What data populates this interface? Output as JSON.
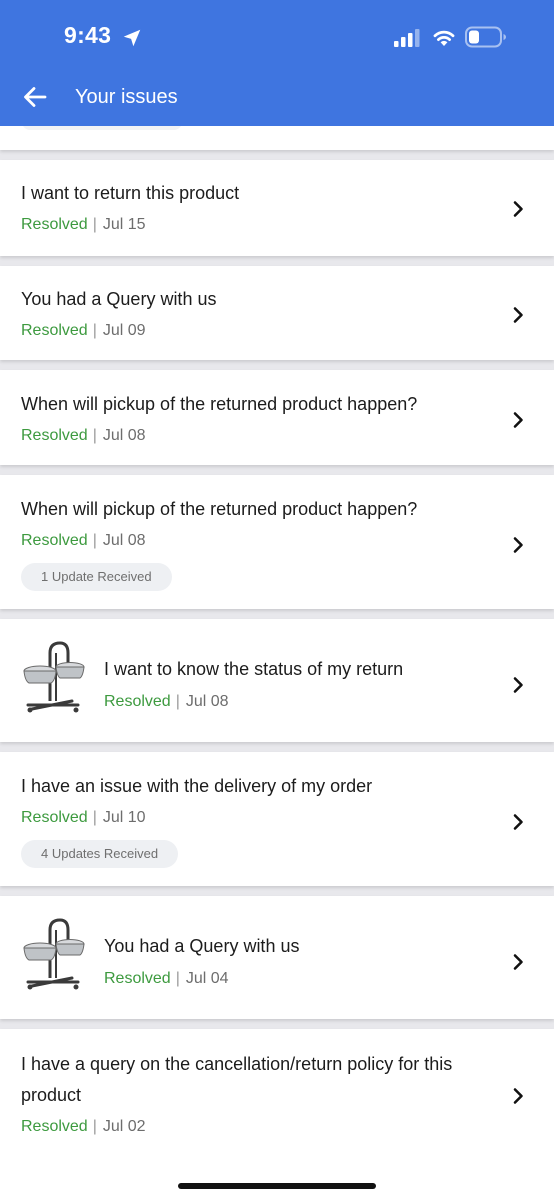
{
  "status_bar": {
    "time": "9:43"
  },
  "header": {
    "title": "Your issues"
  },
  "issues": [
    {
      "title": "I want to return this product",
      "status": "Resolved",
      "date": "Jul 15"
    },
    {
      "title": "You had a Query with us",
      "status": "Resolved",
      "date": "Jul 09"
    },
    {
      "title": "When will pickup of the returned product happen?",
      "status": "Resolved",
      "date": "Jul 08"
    },
    {
      "title": "When will pickup of the returned product happen?",
      "status": "Resolved",
      "date": "Jul 08",
      "chip": "1 Update Received"
    },
    {
      "title": "I want to know the status of my return",
      "status": "Resolved",
      "date": "Jul 08",
      "thumbnail": "pet-bowl-stand"
    },
    {
      "title": "I have an issue with the delivery of my order",
      "status": "Resolved",
      "date": "Jul 10",
      "chip": "4 Updates Received"
    },
    {
      "title": "You had a Query with us",
      "status": "Resolved",
      "date": "Jul 04",
      "thumbnail": "pet-bowl-stand"
    },
    {
      "title_line1": "I have a query on the cancellation/return policy for this",
      "title_line2": "product",
      "status": "Resolved",
      "date": "Jul 02"
    }
  ],
  "colors": {
    "header": "#3f75e0",
    "resolved": "#3d9a3f",
    "background": "#e8e8ec"
  }
}
